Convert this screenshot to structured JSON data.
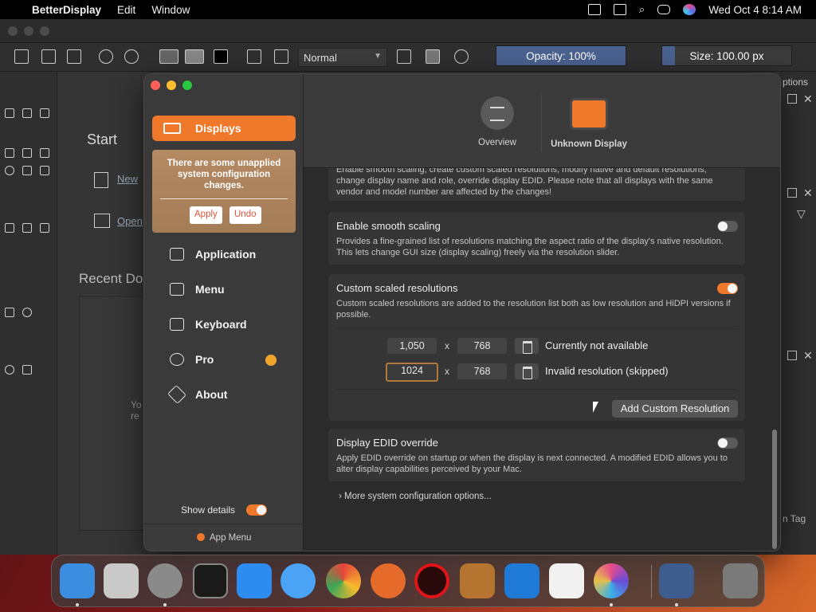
{
  "menubar": {
    "app_name": "BetterDisplay",
    "menus": [
      "Edit",
      "Window"
    ],
    "clock": "Wed Oct 4  8:14 AM"
  },
  "background_app": {
    "blend_mode": "Normal",
    "opacity_label": "Opacity: 100%",
    "size_label": "Size: 100.00 px",
    "start_heading": "Start",
    "new_file": "New",
    "open_file": "Open",
    "recent_documents": "Recent Do",
    "empty_hint_1": "Yo",
    "empty_hint_2": "re",
    "right_dock_title": "ptions",
    "right_dock_tag": "n Tag"
  },
  "sidebar": {
    "active_item": "Displays",
    "warning": {
      "message": "There are some unapplied system configuration changes.",
      "apply_label": "Apply",
      "undo_label": "Undo"
    },
    "items": [
      {
        "label": "Application",
        "icon": "toggles-icon"
      },
      {
        "label": "Menu",
        "icon": "menu-icon"
      },
      {
        "label": "Keyboard",
        "icon": "keyboard-icon"
      },
      {
        "label": "Pro",
        "icon": "verified-badge-icon"
      },
      {
        "label": "About",
        "icon": "tag-icon"
      }
    ],
    "show_details_label": "Show details",
    "show_details_on": true,
    "app_menu_label": "App Menu"
  },
  "header": {
    "tabs": [
      {
        "label": "Overview",
        "icon": "list-icon"
      },
      {
        "label": "Unknown Display",
        "icon": "display-icon"
      }
    ]
  },
  "content": {
    "top_partial_desc_1": "Enable smooth scaling, create custom scaled resolutions, modify native and default resolutions,",
    "top_partial_desc_2": "change display name and role, override display EDID. Please note that all displays with the same",
    "top_partial_desc_3": "vendor and model number are affected by the changes!",
    "smooth_scaling": {
      "title": "Enable smooth scaling",
      "description": "Provides a fine-grained list of resolutions matching the aspect ratio of the display's native resolution. This lets change GUI size (display scaling) freely via the resolution slider.",
      "enabled": false
    },
    "custom_resolutions": {
      "title": "Custom scaled resolutions",
      "description": "Custom scaled resolutions are added to the resolution list both as low resolution and HiDPI versions if possible.",
      "enabled": true,
      "separator": "x",
      "rows": [
        {
          "width": "1,050",
          "height": "768",
          "status": "Currently not available"
        },
        {
          "width": "1024",
          "height": "768",
          "status": "Invalid resolution (skipped)"
        }
      ],
      "add_button": "Add Custom Resolution"
    },
    "edid_override": {
      "title": "Display EDID override",
      "description": "Apply EDID override on startup or when the display is next connected. A modified EDID allows you to alter display capabilities perceived by your Mac.",
      "enabled": false
    },
    "more_options": "More system configuration options..."
  },
  "colors": {
    "accent": "#f0782a",
    "window_bg": "#2b2b2b"
  }
}
